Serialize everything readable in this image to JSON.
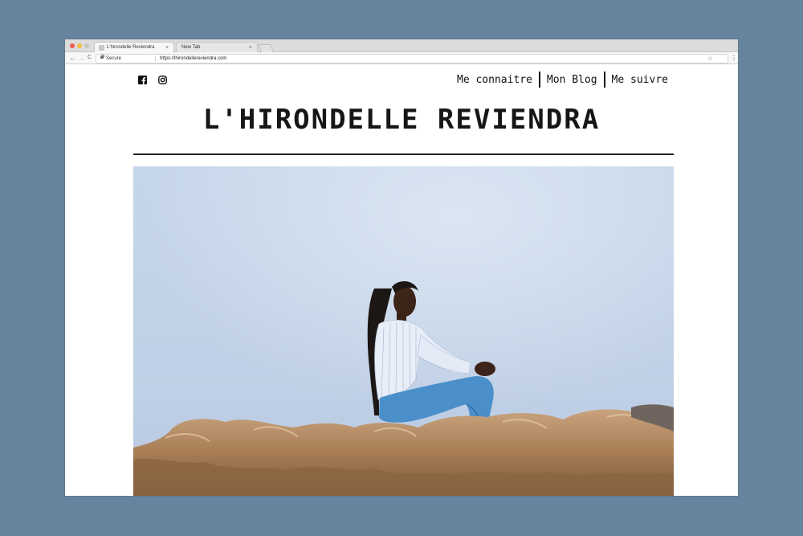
{
  "browser": {
    "tabs": [
      {
        "title": "L'hirondelle Reviendra",
        "close": "×"
      },
      {
        "title": "New Tab",
        "close": "×"
      }
    ],
    "nav": {
      "back": "←",
      "forward": "→",
      "reload": "C"
    },
    "address": {
      "secure_label": "Secure",
      "url": "https://lhirondellereviendra.com"
    },
    "star": "☆",
    "menu": "⋮"
  },
  "site": {
    "title": "L'HIRONDELLE REVIENDRA",
    "social": [
      "facebook-icon",
      "instagram-icon"
    ],
    "nav": [
      {
        "label": "Me connaitre"
      },
      {
        "label": "Mon Blog"
      },
      {
        "label": "Me suivre"
      }
    ]
  },
  "hero": {
    "subject": "woman sitting on rocks against sky",
    "colors": {
      "sky_top": "#cbdaeb",
      "sky_bottom": "#bccbe2",
      "rock": "#b48b63",
      "shirt": "#e9eef8",
      "jeans": "#4a90c8"
    }
  }
}
